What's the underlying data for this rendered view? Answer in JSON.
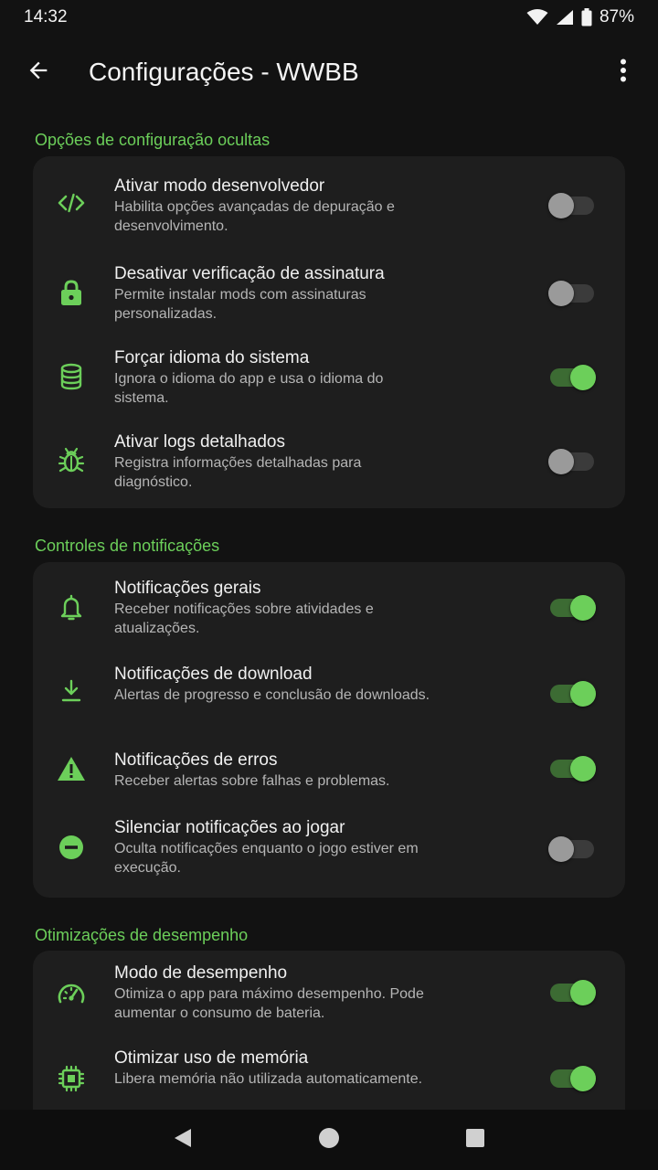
{
  "status": {
    "time": "14:32",
    "battery": "87%"
  },
  "appbar": {
    "title": "Configurações - WWBB"
  },
  "colors": {
    "accent": "#6ccf5a",
    "background": "#121212",
    "card": "#1e1e1e"
  },
  "sections": [
    {
      "title": "Opções de configuração ocultas",
      "items": [
        {
          "icon": "code-icon",
          "title": "Ativar modo desenvolvedor",
          "desc": "Habilita opções avançadas de depuração e desenvolvimento.",
          "on": false
        },
        {
          "icon": "lock-icon",
          "title": "Desativar verificação de assinatura",
          "desc": "Permite instalar mods com assinaturas personalizadas.",
          "on": false
        },
        {
          "icon": "database-icon",
          "title": "Forçar idioma do sistema",
          "desc": "Ignora o idioma do app e usa o idioma do sistema.",
          "on": true
        },
        {
          "icon": "bug-icon",
          "title": "Ativar logs detalhados",
          "desc": "Registra informações detalhadas para diagnóstico.",
          "on": false
        }
      ]
    },
    {
      "title": "Controles de notificações",
      "items": [
        {
          "icon": "bell-icon",
          "title": "Notificações gerais",
          "desc": "Receber notificações sobre atividades e atualizações.",
          "on": true
        },
        {
          "icon": "download-icon",
          "title": "Notificações de download",
          "desc": "Alertas de progresso e conclusão de downloads.",
          "on": true
        },
        {
          "icon": "warning-icon",
          "title": "Notificações de erros",
          "desc": "Receber alertas sobre falhas e problemas.",
          "on": true
        },
        {
          "icon": "do-not-disturb-icon",
          "title": "Silenciar notificações ao jogar",
          "desc": "Oculta notificações enquanto o jogo estiver em execução.",
          "on": false
        }
      ]
    },
    {
      "title": "Otimizações de desempenho",
      "items": [
        {
          "icon": "speedometer-icon",
          "title": "Modo de desempenho",
          "desc": "Otimiza o app para máximo desempenho. Pode aumentar o consumo de bateria.",
          "on": true
        },
        {
          "icon": "memory-chip-icon",
          "title": "Otimizar uso de memória",
          "desc": "Libera memória não utilizada automaticamente.",
          "on": true
        }
      ]
    }
  ]
}
